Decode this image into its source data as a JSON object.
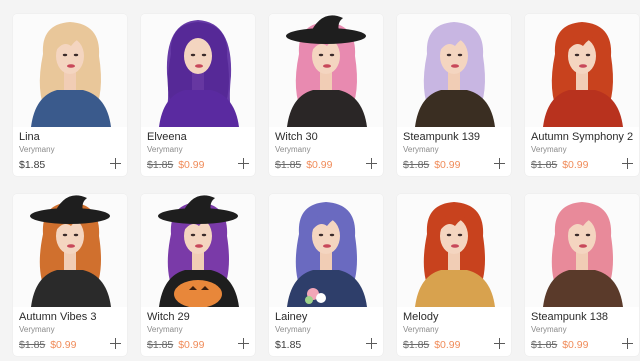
{
  "products": [
    {
      "title": "Lina",
      "author": "Verymany",
      "price": "$1.85",
      "old_price": null,
      "new_price": null,
      "hair": "#e9c79a",
      "outfit": "#3a5a8c",
      "hat": null
    },
    {
      "title": "Elveena",
      "author": "Verymany",
      "price": null,
      "old_price": "$1.85",
      "new_price": "$0.99",
      "hair": "#2b1a3a",
      "outfit": "#5a2aa0",
      "hat": "hood"
    },
    {
      "title": "Witch 30",
      "author": "Verymany",
      "price": null,
      "old_price": "$1.85",
      "new_price": "$0.99",
      "hair": "#e88ab0",
      "outfit": "#2a2626",
      "hat": "witch"
    },
    {
      "title": "Steampunk 139",
      "author": "Verymany",
      "price": null,
      "old_price": "$1.85",
      "new_price": "$0.99",
      "hair": "#c8b6e2",
      "outfit": "#3a2e22",
      "hat": null
    },
    {
      "title": "Autumn Symphony 2",
      "author": "Verymany",
      "price": null,
      "old_price": "$1.85",
      "new_price": "$0.99",
      "hair": "#c8421e",
      "outfit": "#b8321e",
      "hat": null
    },
    {
      "title": "Autumn Vibes 3",
      "author": "Verymany",
      "price": null,
      "old_price": "$1.85",
      "new_price": "$0.99",
      "hair": "#d0702e",
      "outfit": "#2a2a2a",
      "hat": "witch"
    },
    {
      "title": "Witch 29",
      "author": "Verymany",
      "price": null,
      "old_price": "$1.85",
      "new_price": "$0.99",
      "hair": "#7a3aa8",
      "outfit": "#1e1e1e",
      "hat": "witch"
    },
    {
      "title": "Lainey",
      "author": "Verymany",
      "price": "$1.85",
      "old_price": null,
      "new_price": null,
      "hair": "#6a6ac0",
      "outfit": "#2e3e6a",
      "hat": null
    },
    {
      "title": "Melody",
      "author": "Verymany",
      "price": null,
      "old_price": "$1.85",
      "new_price": "$0.99",
      "hair": "#c8421e",
      "outfit": "#d8a24e",
      "hat": null
    },
    {
      "title": "Steampunk 138",
      "author": "Verymany",
      "price": null,
      "old_price": "$1.85",
      "new_price": "$0.99",
      "hair": "#e88a9a",
      "outfit": "#5a3a2a",
      "hat": null
    }
  ],
  "colors": {
    "sale_price": "#f08c5a",
    "background": "#f4f4f4",
    "card": "#ffffff"
  },
  "icons": {
    "add": "plus-icon"
  }
}
